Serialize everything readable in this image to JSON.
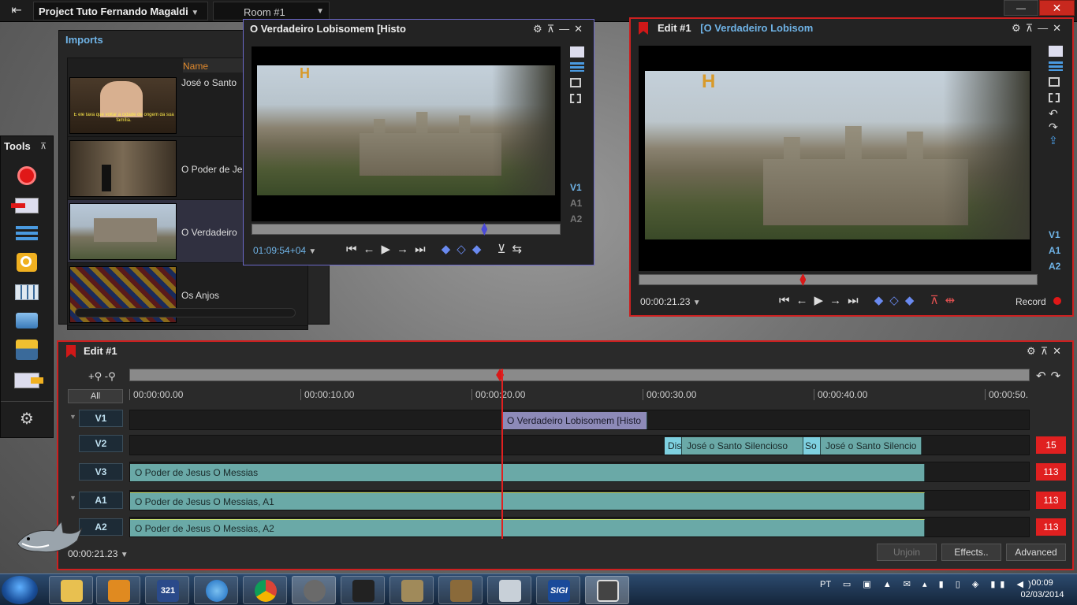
{
  "topbar": {
    "project_name": "Project Tuto Fernando Magaldi",
    "room": "Room #1"
  },
  "imports": {
    "title": "Imports",
    "column_header": "Name",
    "items": [
      {
        "name": "José o Santo"
      },
      {
        "name": "O Poder de Je"
      },
      {
        "name": "O Verdadeiro"
      },
      {
        "name": "Os Anjos"
      }
    ],
    "thumb_subtitle": "E ele tava que voltar à cidade de origem da sua família."
  },
  "tools": {
    "title": "Tools"
  },
  "source_viewer": {
    "title": "O Verdadeiro Lobisomem [Histo",
    "timecode": "01:09:54+04",
    "progress": 0.76,
    "tracks": [
      "V1",
      "A1",
      "A2"
    ],
    "active_track": "V1"
  },
  "record_viewer": {
    "title_prefix": "Edit #1",
    "title_clip": "[O Verdadeiro Lobisom",
    "timecode": "00:00:21.23",
    "record_label": "Record",
    "progress": 0.41,
    "tracks": [
      "V1",
      "A1",
      "A2"
    ]
  },
  "timeline": {
    "title": "Edit #1",
    "all_label": "All",
    "ruler": [
      "00:00:00.00",
      "00:00:10.00",
      "00:00:20.00",
      "00:00:30.00",
      "00:00:40.00",
      "00:00:50."
    ],
    "tracks": [
      {
        "label": "V1"
      },
      {
        "label": "V2",
        "count": "15"
      },
      {
        "label": "V3",
        "count": "113"
      },
      {
        "label": "A1",
        "count": "113"
      },
      {
        "label": "A2",
        "count": "113"
      }
    ],
    "clips": {
      "v1": "O Verdadeiro Lobisomem [Histo",
      "v2a": "Dis",
      "v2b": "José o Santo Silencioso",
      "v2c": "So",
      "v2d": "José o Santo Silencio",
      "v3": "O Poder de Jesus   O Messias",
      "a1": "O Poder de Jesus   O Messias, A1",
      "a2": "O Poder de Jesus   O Messias, A2"
    },
    "timecode": "00:00:21.23",
    "buttons": {
      "unjoin": "Unjoin",
      "effects": "Effects..",
      "advanced": "Advanced"
    }
  },
  "taskbar": {
    "language": "PT",
    "time": "00:09",
    "date": "02/03/2014",
    "app_321": "321",
    "app_sigi": "SIGI"
  },
  "colors": {
    "accent_blue": "#6fb3e6",
    "record_red": "#cc2020",
    "clip_teal": "#6aa9a7",
    "clip_v1": "#8d8ab8",
    "orange_header": "#e0892c"
  }
}
